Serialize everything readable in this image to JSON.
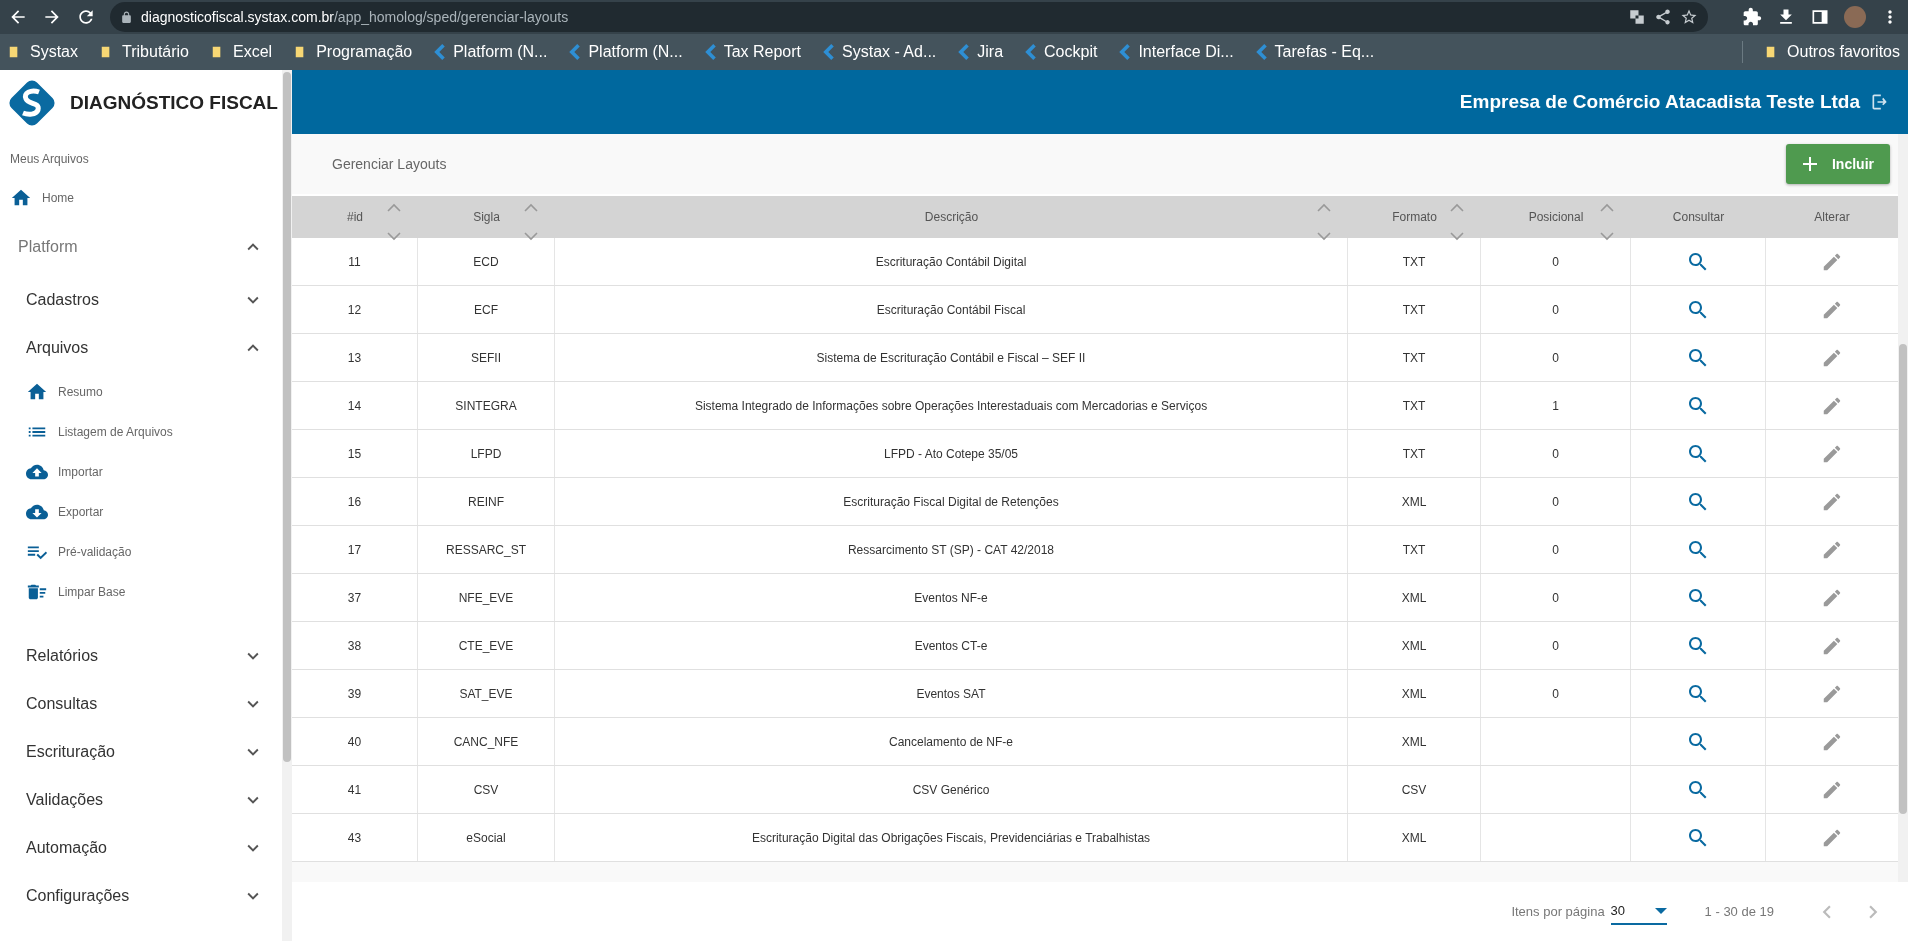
{
  "browser": {
    "url_host": "diagnosticofiscal.systax.com.br",
    "url_path": "/app_homolog/sped/gerenciar-layouts",
    "bookmarks": [
      {
        "label": "Systax",
        "kind": "folder"
      },
      {
        "label": "Tributário",
        "kind": "folder"
      },
      {
        "label": "Excel",
        "kind": "folder"
      },
      {
        "label": "Programação",
        "kind": "folder"
      },
      {
        "label": "Platform (N...",
        "kind": "link"
      },
      {
        "label": "Platform (N...",
        "kind": "link"
      },
      {
        "label": "Tax Report",
        "kind": "link"
      },
      {
        "label": "Systax - Ad...",
        "kind": "link"
      },
      {
        "label": "Jira",
        "kind": "link"
      },
      {
        "label": "Cockpit",
        "kind": "link"
      },
      {
        "label": "Interface Di...",
        "kind": "link"
      },
      {
        "label": "Tarefas - Eq...",
        "kind": "link"
      }
    ],
    "other_bookmarks": "Outros favoritos"
  },
  "sidebar": {
    "logo_text": "DIAGNÓSTICO FISCAL",
    "section_label": "Meus Arquivos",
    "home": {
      "label": "Home",
      "kind": "home"
    },
    "groups": [
      {
        "label": "Platform",
        "expanded": true,
        "children": [
          {
            "label": "Cadastros",
            "expanded": false
          },
          {
            "label": "Arquivos",
            "expanded": true,
            "children": [
              {
                "label": "Resumo",
                "kind": "home"
              },
              {
                "label": "Listagem de Arquivos",
                "kind": "list"
              },
              {
                "label": "Importar",
                "kind": "upload"
              },
              {
                "label": "Exportar",
                "kind": "download"
              },
              {
                "label": "Pré-validação",
                "kind": "check"
              },
              {
                "label": "Limpar Base",
                "kind": "trash"
              }
            ]
          },
          {
            "label": "Relatórios",
            "expanded": false
          },
          {
            "label": "Consultas",
            "expanded": false
          },
          {
            "label": "Escrituração",
            "expanded": false
          },
          {
            "label": "Validações",
            "expanded": false
          },
          {
            "label": "Automação",
            "expanded": false
          },
          {
            "label": "Configurações",
            "expanded": false
          }
        ]
      }
    ]
  },
  "header": {
    "company": "Empresa de Comércio Atacadista Teste Ltda"
  },
  "page": {
    "title": "Gerenciar Layouts",
    "add_button": "Incluir"
  },
  "table": {
    "columns": [
      {
        "label": "#id",
        "sortable": true
      },
      {
        "label": "Sigla",
        "sortable": true
      },
      {
        "label": "Descrição",
        "sortable": true
      },
      {
        "label": "Formato",
        "sortable": true
      },
      {
        "label": "Posicional",
        "sortable": true
      },
      {
        "label": "Consultar",
        "sortable": false
      },
      {
        "label": "Alterar",
        "sortable": false
      }
    ],
    "rows": [
      {
        "id": "11",
        "sigla": "ECD",
        "descricao": "Escrituração Contábil Digital",
        "formato": "TXT",
        "posicional": "0"
      },
      {
        "id": "12",
        "sigla": "ECF",
        "descricao": "Escrituração Contábil Fiscal",
        "formato": "TXT",
        "posicional": "0"
      },
      {
        "id": "13",
        "sigla": "SEFII",
        "descricao": "Sistema de Escrituração Contábil e Fiscal – SEF II",
        "formato": "TXT",
        "posicional": "0"
      },
      {
        "id": "14",
        "sigla": "SINTEGRA",
        "descricao": "Sistema Integrado de Informações sobre Operações Interestaduais com Mercadorias e Serviços",
        "formato": "TXT",
        "posicional": "1"
      },
      {
        "id": "15",
        "sigla": "LFPD",
        "descricao": "LFPD - Ato Cotepe 35/05",
        "formato": "TXT",
        "posicional": "0"
      },
      {
        "id": "16",
        "sigla": "REINF",
        "descricao": "Escrituração Fiscal Digital de Retenções",
        "formato": "XML",
        "posicional": "0"
      },
      {
        "id": "17",
        "sigla": "RESSARC_ST",
        "descricao": "Ressarcimento ST (SP) - CAT 42/2018",
        "formato": "TXT",
        "posicional": "0"
      },
      {
        "id": "37",
        "sigla": "NFE_EVE",
        "descricao": "Eventos NF-e",
        "formato": "XML",
        "posicional": "0"
      },
      {
        "id": "38",
        "sigla": "CTE_EVE",
        "descricao": "Eventos CT-e",
        "formato": "XML",
        "posicional": "0"
      },
      {
        "id": "39",
        "sigla": "SAT_EVE",
        "descricao": "Eventos SAT",
        "formato": "XML",
        "posicional": "0"
      },
      {
        "id": "40",
        "sigla": "CANC_NFE",
        "descricao": "Cancelamento de NF-e",
        "formato": "XML"
      },
      {
        "id": "41",
        "sigla": "CSV",
        "descricao": "CSV Genérico",
        "formato": "CSV"
      },
      {
        "id": "43",
        "sigla": "eSocial",
        "descricao": "Escrituração Digital das Obrigações Fiscais, Previdenciárias e Trabalhistas",
        "formato": "XML"
      }
    ]
  },
  "pagination": {
    "label": "Itens por página",
    "page_size": "30",
    "range": "1 - 30 de 19"
  }
}
